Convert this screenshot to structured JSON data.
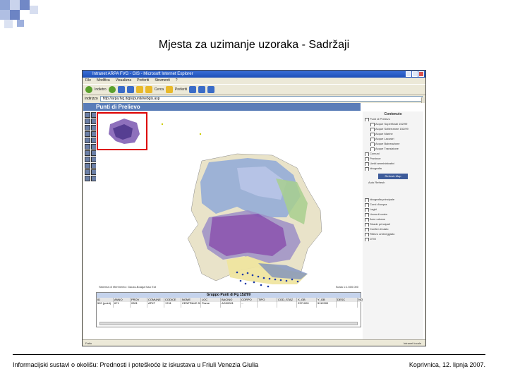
{
  "slide": {
    "title": "Mjesta za uzimanje uzoraka - Sadržaji",
    "footer_left": "Informacijski sustavi o okolišu: Prednosti i poteškoće iz iskustava u Friuli Venezia Giulia",
    "footer_right": "Koprivnica, 12. lipnja 2007."
  },
  "browser": {
    "window_title": "Intranet ARPA FVG - GIS - Microsoft Internet Explorer",
    "menu": [
      "File",
      "Modifica",
      "Visualizza",
      "Preferiti",
      "Strumenti",
      "?"
    ],
    "toolbar": [
      "Indietro",
      "Cerca",
      "Preferiti"
    ],
    "address_label": "Indirizzo",
    "address_value": "http://arpa.fvg.it/gis/punti/webgis.asp",
    "status_text": "Fatto",
    "status_zone": "Intranet locale"
  },
  "app": {
    "header": "Punti di Prelievo",
    "scale_left": "Sistema di riferimento: Gauss-Boaga fuso Est",
    "scale_right": "Scala 1:1.500.000",
    "table": {
      "title": "Gruppo Punti di Pg 152/99",
      "columns": [
        "ID",
        "ANNO",
        "PROV",
        "COMUNE",
        "CODICE",
        "NOME",
        "LOC",
        "BACINO",
        "CORPO",
        "TIPO",
        "COD_STAZ",
        "X_GB",
        "Y_GB",
        "DESC",
        "NOTE"
      ],
      "rows": [
        [
          "520 (point)",
          "671",
          "0301",
          "AP4T",
          "1741",
          "CENTRALE DI COMUNE",
          "Fiume",
          "AG00001",
          "...",
          "",
          "",
          "2371000",
          "5112000",
          "",
          ""
        ]
      ]
    },
    "legend": {
      "title": "Contenuto",
      "items": [
        {
          "label": "Punti di Prelievo",
          "level": 1
        },
        {
          "label": "Acque Superficiali 152/99",
          "level": 2
        },
        {
          "label": "Acque Sotterranee 152/99",
          "level": 2
        },
        {
          "label": "Acque Marine",
          "level": 2
        },
        {
          "label": "Acque Lacustri",
          "level": 2
        },
        {
          "label": "Acque Balneazione",
          "level": 2
        },
        {
          "label": "Acque Transizione",
          "level": 2
        },
        {
          "label": "Comuni",
          "level": 1
        },
        {
          "label": "Province",
          "level": 1
        },
        {
          "label": "Limiti amministrativi",
          "level": 1
        },
        {
          "label": "Idrografia",
          "level": 1
        }
      ],
      "refresh_label": "Refresh Map",
      "auto_refresh_label": "Auto Refresh",
      "lower_items": [
        "Idrografia principale",
        "Corsi d'acqua",
        "Laghi",
        "Linea di costa",
        "Aree urbane",
        "Strade principali",
        "Confini di stato",
        "Rilievo ombreggiato",
        "DTM"
      ]
    }
  }
}
